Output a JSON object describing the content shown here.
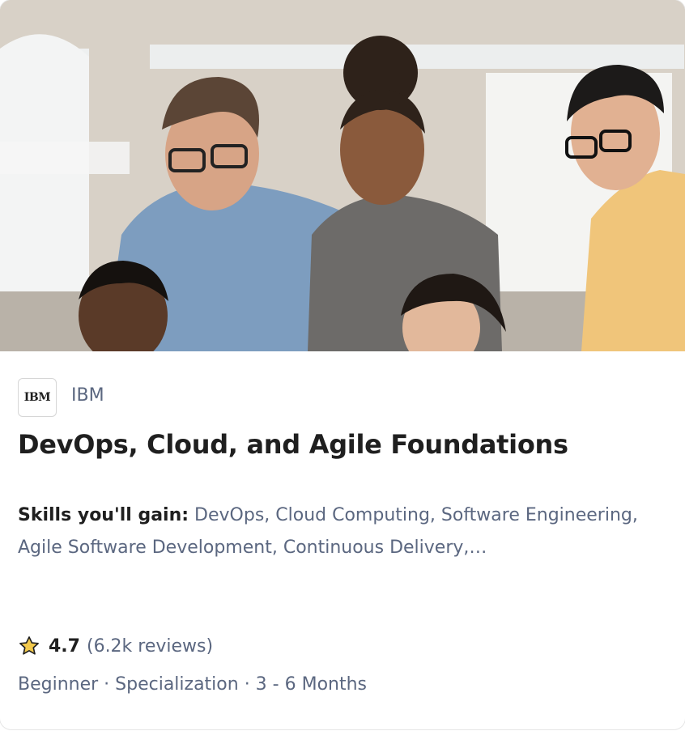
{
  "card": {
    "image_alt": "Group of people looking at a screen",
    "partner": {
      "logo_text": "IBM",
      "name": "IBM"
    },
    "title": "DevOps, Cloud, and Agile Foundations",
    "skills": {
      "label": "Skills you'll gain:",
      "list": "DevOps, Cloud Computing, Software Engineering, Agile Software Development, Continuous Delivery,…"
    },
    "rating": {
      "score": "4.7",
      "reviews": "(6.2k reviews)",
      "star_color": "#f2c94c"
    },
    "meta": "Beginner · Specialization · 3 - 6 Months"
  }
}
